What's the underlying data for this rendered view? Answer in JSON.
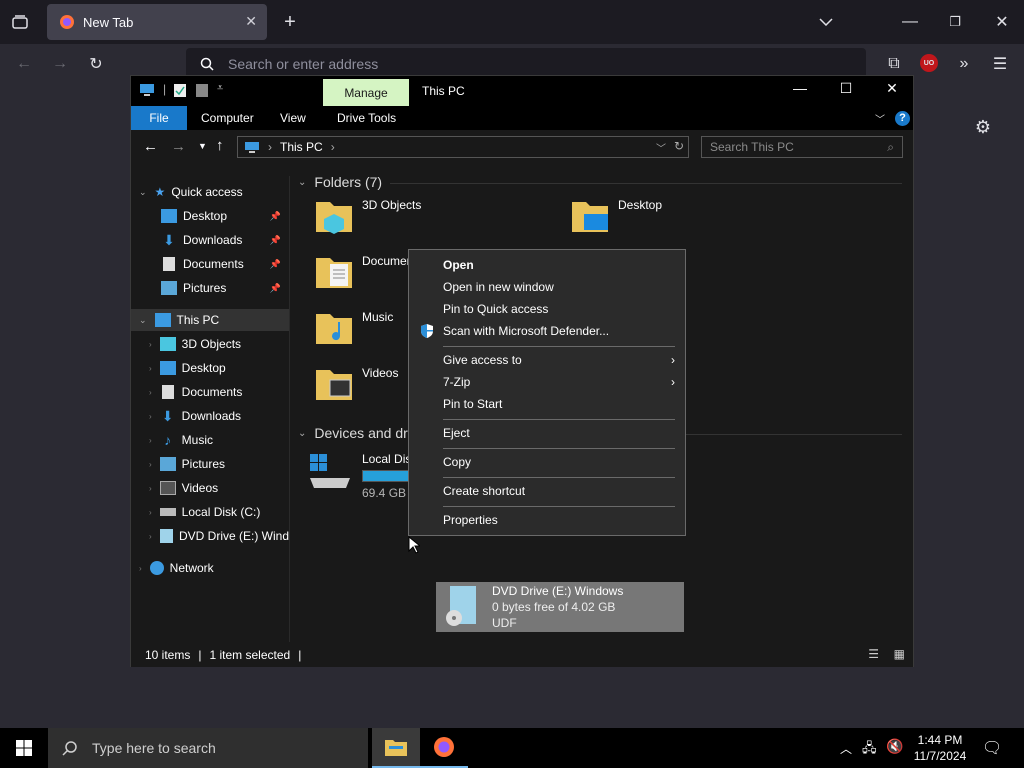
{
  "browser": {
    "tab_title": "New Tab",
    "address_placeholder": "Search or enter address"
  },
  "explorer": {
    "window_title": "This PC",
    "context_tab": "Manage",
    "ribbon_tabs": [
      "File",
      "Computer",
      "View",
      "Drive Tools"
    ],
    "address_path": "This PC",
    "search_placeholder": "Search This PC",
    "nav": {
      "quick_access": "Quick access",
      "quick_items": [
        "Desktop",
        "Downloads",
        "Documents",
        "Pictures"
      ],
      "this_pc": "This PC",
      "pc_items": [
        "3D Objects",
        "Desktop",
        "Documents",
        "Downloads",
        "Music",
        "Pictures",
        "Videos",
        "Local Disk (C:)",
        "DVD Drive (E:) Wind"
      ],
      "network": "Network"
    },
    "folders_header": "Folders (7)",
    "folders": [
      "3D Objects",
      "Desktop",
      "Documents",
      "Music",
      "Videos"
    ],
    "devices_header": "Devices and drives (3)",
    "drives": [
      {
        "name": "Local Disk (C:)",
        "sub": "69.4 GB free of 126 GB",
        "fill": 0.45
      },
      {
        "name": "DVD Drive (E:) Windows",
        "sub": "0 bytes free of 4.02 GB",
        "sub2": "UDF"
      }
    ],
    "status": {
      "items": "10 items",
      "selected": "1 item selected"
    }
  },
  "context_menu": {
    "items": [
      "Open",
      "Open in new window",
      "Pin to Quick access",
      "Scan with Microsoft Defender...",
      "Give access to",
      "7-Zip",
      "Pin to Start",
      "Eject",
      "Copy",
      "Create shortcut",
      "Properties"
    ]
  },
  "taskbar": {
    "search_placeholder": "Type here to search",
    "time": "1:44 PM",
    "date": "11/7/2024"
  },
  "colors": {
    "accent": "#1979ca",
    "manage_tab": "#d5f4c3",
    "drive_bar": "#26a0da"
  }
}
